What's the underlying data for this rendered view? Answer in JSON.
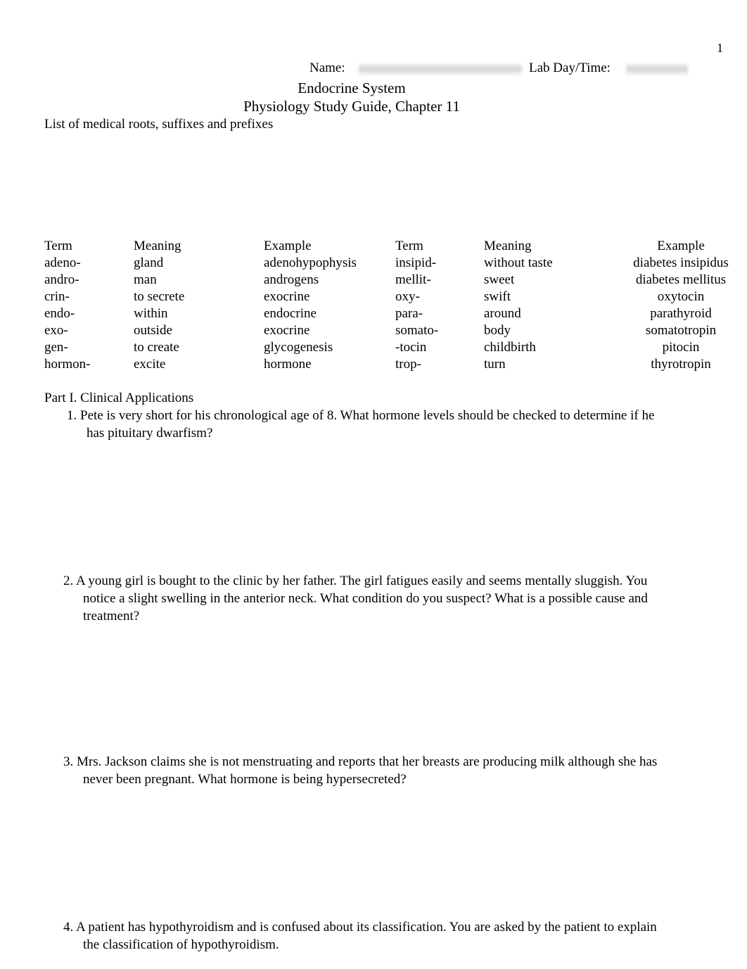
{
  "page": {
    "number": "1"
  },
  "header": {
    "name_label": "Name:",
    "name_value": "",
    "lab_label": "Lab Day/Time:",
    "lab_value": ""
  },
  "document": {
    "title": "Endocrine System",
    "subtitle": "Physiology Study Guide, Chapter 11",
    "intro": "List of medical roots, suffixes and prefixes"
  },
  "glossary": {
    "left": {
      "headers": [
        "Term",
        "Meaning",
        "Example"
      ],
      "rows": [
        [
          "adeno-",
          "gland",
          "adenohypophysis"
        ],
        [
          "andro-",
          "man",
          "androgens"
        ],
        [
          "crin-",
          "to secrete",
          "exocrine"
        ],
        [
          "endo-",
          "within",
          "endocrine"
        ],
        [
          "exo-",
          "outside",
          "exocrine"
        ],
        [
          "gen-",
          "to create",
          "glycogenesis"
        ],
        [
          "hormon-",
          "excite",
          "hormone"
        ]
      ]
    },
    "right": {
      "headers": [
        "Term",
        "Meaning",
        "Example"
      ],
      "rows": [
        [
          "insipid-",
          "without taste",
          "diabetes insipidus"
        ],
        [
          "mellit-",
          "sweet",
          "diabetes mellitus"
        ],
        [
          "oxy-",
          "swift",
          "oxytocin"
        ],
        [
          "para-",
          "around",
          "parathyroid"
        ],
        [
          "somato-",
          "body",
          "somatotropin"
        ],
        [
          "-tocin",
          "childbirth",
          "pitocin"
        ],
        [
          "trop-",
          "turn",
          "thyrotropin"
        ]
      ]
    }
  },
  "part1": {
    "heading": "Part I. Clinical Applications",
    "questions": [
      "1. Pete is very short for his chronological age of 8. What hormone levels should be checked to determine if he has pituitary dwarfism?",
      "2. A young girl is bought to the clinic by her father. The girl fatigues easily and seems mentally sluggish. You notice a slight swelling in the anterior neck. What condition do you suspect? What is a possible cause and treatment?",
      "3. Mrs. Jackson claims she is not menstruating and reports that her breasts are producing milk although she has never been pregnant. What hormone is being hypersecreted?",
      "4. A patient has hypothyroidism and is confused about its classification. You are asked by the patient to explain the classification of hypothyroidism."
    ]
  }
}
